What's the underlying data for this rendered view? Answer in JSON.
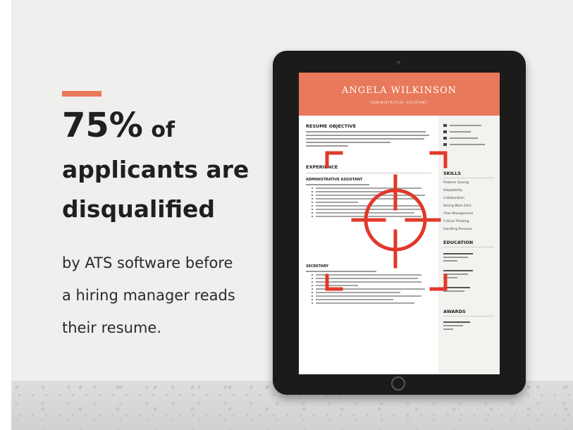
{
  "headline": {
    "percent": "75%",
    "of": "of",
    "line2": "applicants are",
    "line3": "disqualified"
  },
  "subtext": {
    "line1": "by ATS software before",
    "line2": "a hiring manager reads",
    "line3": "their resume."
  },
  "resume": {
    "name": "ANGELA WILKINSON",
    "role": "ADMINISTRATIVE ASSISTANT",
    "objective_title": "RESUME OBJECTIVE",
    "experience_title": "EXPERIENCE",
    "job1_title": "ADMINISTRATIVE ASSISTANT",
    "job2_title": "SECRETARY",
    "skills_title": "SKILLS",
    "skills": [
      "Problem Solving",
      "Adaptability",
      "Collaboration",
      "Strong Work Ethic",
      "Time Management",
      "Critical Thinking",
      "Handling Pressure"
    ],
    "education_title": "EDUCATION",
    "awards_title": "AWARDS"
  },
  "colors": {
    "accent": "#e8795a",
    "crosshair": "#e0392b",
    "text": "#1f1f1f"
  },
  "icons": {
    "crosshair": "target-crosshair-icon"
  }
}
